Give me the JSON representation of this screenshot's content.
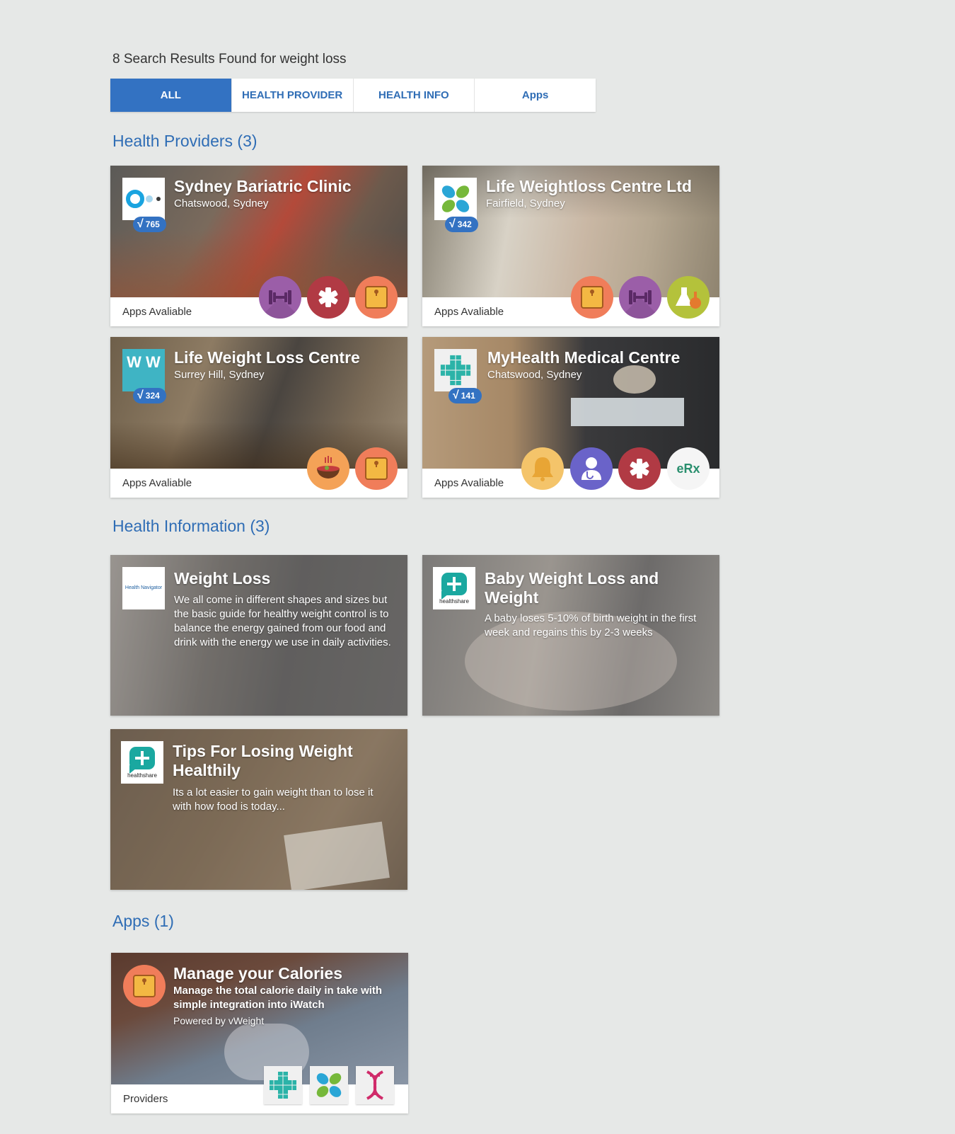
{
  "search": {
    "results_text": "8 Search Results Found for weight loss"
  },
  "tabs": [
    {
      "label": "ALL",
      "active": true
    },
    {
      "label": "HEALTH PROVIDER",
      "active": false
    },
    {
      "label": "HEALTH INFO",
      "active": false
    },
    {
      "label": "Apps",
      "active": false
    }
  ],
  "sections": {
    "providers_title": "Health Providers (3)",
    "info_title": "Health Information (3)",
    "apps_title": "Apps (1)"
  },
  "providers": [
    {
      "name": "Sydney Bariatric Clinic",
      "location": "Chatswood, Sydney",
      "verified_count": "765",
      "footer_label": "Apps Avaliable",
      "logo_icon": "circle-dots-logo",
      "apps": [
        "dumbbell-icon",
        "medical-star-icon",
        "scale-icon"
      ]
    },
    {
      "name": "Life Weightloss Centre Ltd",
      "location": "Fairfield, Sydney",
      "verified_count": "342",
      "footer_label": "Apps Avaliable",
      "logo_icon": "petal-logo",
      "apps": [
        "scale-icon",
        "dumbbell-icon",
        "lab-flask-icon"
      ]
    },
    {
      "name": "Life Weight Loss Centre",
      "location": "Surrey Hill, Sydney",
      "verified_count": "324",
      "footer_label": "Apps Avaliable",
      "logo_icon": "ww-logo",
      "logo_text": "W W",
      "apps": [
        "food-bowl-icon",
        "scale-icon"
      ]
    },
    {
      "name": "MyHealth Medical Centre",
      "location": "Chatswood, Sydney",
      "verified_count": "141",
      "footer_label": "Apps Avaliable",
      "logo_icon": "green-cross-logo",
      "apps": [
        "bell-icon",
        "doctor-icon",
        "medical-star-icon",
        "erx-icon"
      ],
      "erx_text": "eRx"
    }
  ],
  "info": [
    {
      "title": "Weight Loss",
      "description": "We all come in different shapes and sizes but the basic guide for healthy weight control is to balance the energy gained from our food and drink with the energy we use in daily activities.",
      "logo_icon": "health-navigator-logo",
      "logo_text": "Health Navigator"
    },
    {
      "title": "Baby Weight Loss and Weight",
      "description": "A baby loses 5-10% of birth weight in the first week and regains this by 2-3 weeks",
      "logo_icon": "healthshare-logo",
      "logo_text": "healthshare"
    },
    {
      "title": "Tips For Losing Weight Healthily",
      "description": "Its a lot easier to gain weight than to lose it with how food is today...",
      "logo_icon": "healthshare-logo",
      "logo_text": "healthshare"
    }
  ],
  "apps": [
    {
      "title": "Manage your Calories",
      "description": "Manage the total calorie daily in take with simple integration into iWatch",
      "powered_by": "Powered by vWeight",
      "footer_label": "Providers",
      "logo_icon": "scale-icon",
      "providers": [
        "green-cross-logo",
        "petal-logo",
        "dna-icon"
      ]
    }
  ],
  "colors": {
    "accent": "#3372c2",
    "background": "#e6e8e7"
  }
}
